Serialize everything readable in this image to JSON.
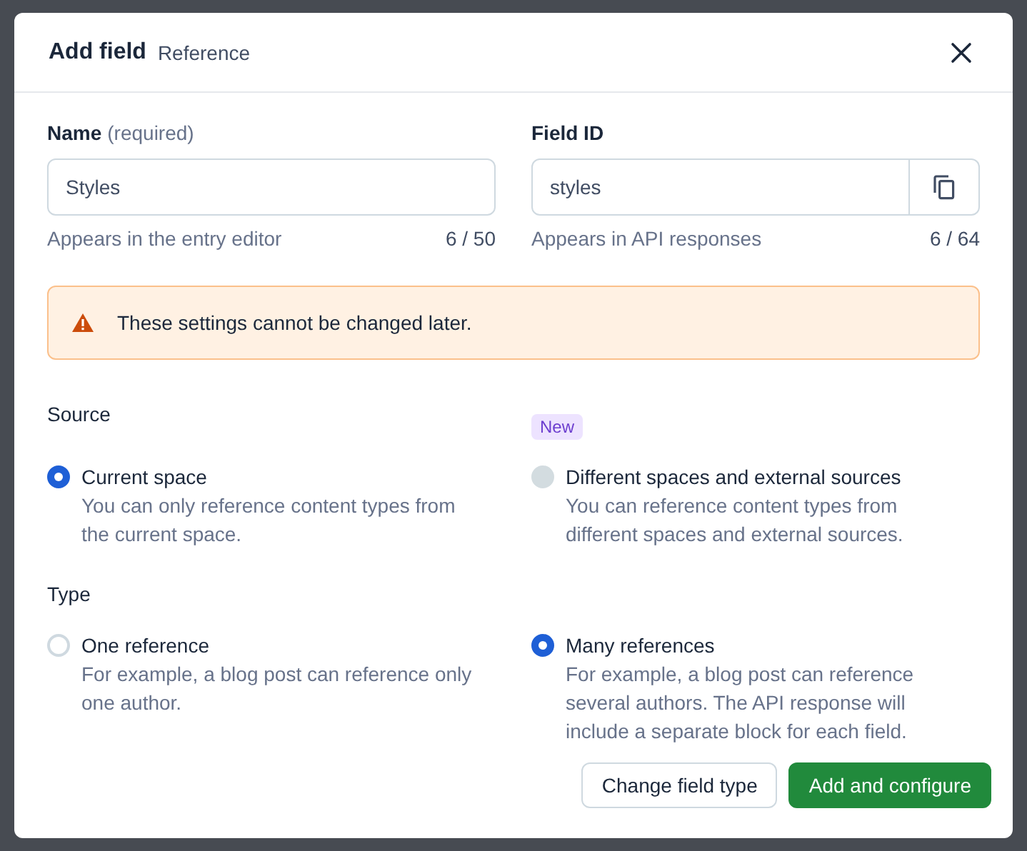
{
  "dialog": {
    "title": "Add field",
    "subtitle": "Reference"
  },
  "fields": [
    {
      "label": "Name",
      "label_hint": "(required)",
      "value": "Styles",
      "help": "Appears in the entry editor",
      "count": "6 / 50",
      "copy_button": false
    },
    {
      "label": "Field ID",
      "value": "styles",
      "help": "Appears in API responses",
      "count": "6 / 64",
      "copy_button": true
    }
  ],
  "warning": "These settings cannot be changed later.",
  "groups": [
    {
      "title": "Source",
      "options": [
        {
          "label": "Current space",
          "description": "You can only reference content types from the current space.",
          "selected": true,
          "disabled": false
        },
        {
          "label": "Different spaces and external sources",
          "description": "You can reference content types from different spaces and external sources.",
          "selected": false,
          "disabled": true,
          "badge": "New"
        }
      ]
    },
    {
      "title": "Type",
      "options": [
        {
          "label": "One reference",
          "description": "For example, a blog post can reference only one author.",
          "selected": false,
          "disabled": false
        },
        {
          "label": "Many references",
          "description": "For example, a blog post can reference several authors. The API response will include a separate block for each field.",
          "selected": true,
          "disabled": false
        }
      ]
    }
  ],
  "buttons": [
    {
      "label": "Change field type",
      "kind": "secondary"
    },
    {
      "label": "Add and configure",
      "kind": "primary"
    }
  ]
}
